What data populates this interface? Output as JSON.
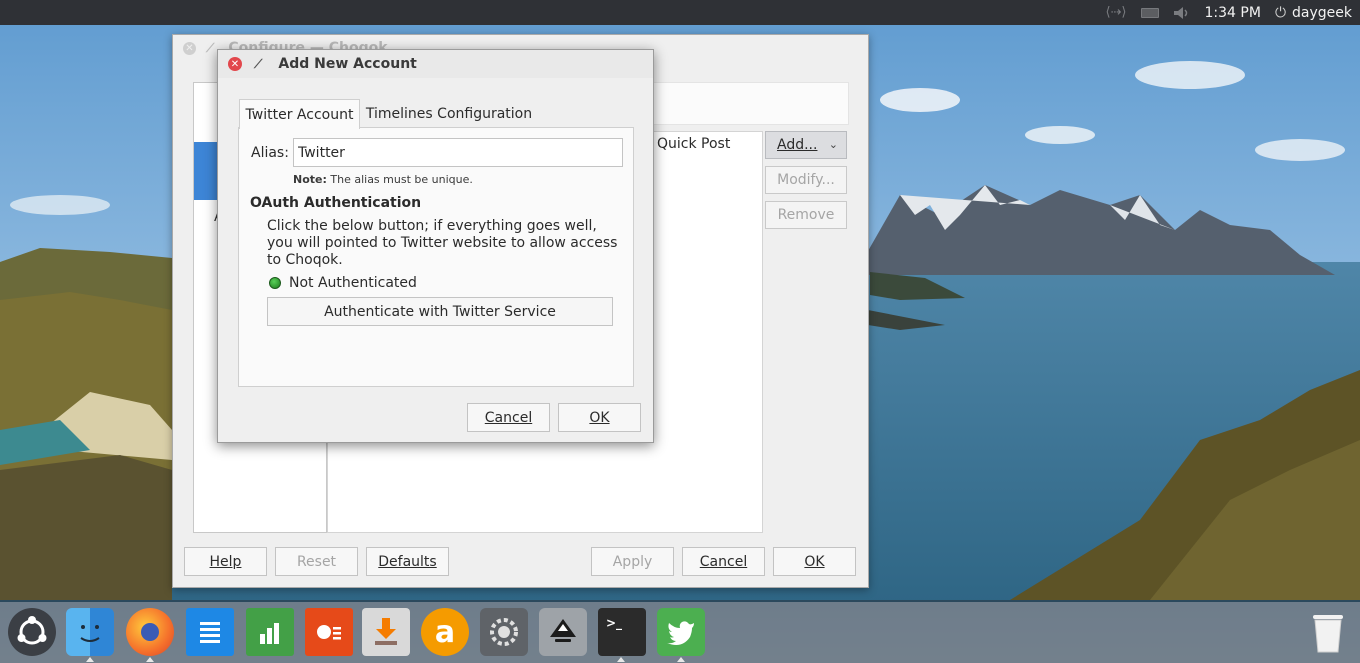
{
  "colors": {
    "accent": "#3d85d6",
    "close_red": "#e2474c",
    "status_green": "#1fa01f",
    "panel_bg": "#2f3136"
  },
  "top_panel": {
    "clock": "1:34 PM",
    "user": "daygeek",
    "icons": [
      "network-icon",
      "battery-icon",
      "volume-icon",
      "power-icon"
    ]
  },
  "config_window": {
    "title": "Configure — Choqok",
    "sidebar_stub": "A",
    "column_quick_post": "Quick Post",
    "buttons": {
      "add": "Add...",
      "modify": "Modify...",
      "remove": "Remove",
      "help": "Help",
      "reset": "Reset",
      "defaults": "Defaults",
      "apply": "Apply",
      "cancel": "Cancel",
      "ok": "OK"
    }
  },
  "dialog": {
    "title": "Add New Account",
    "tabs": [
      {
        "label": "Twitter Account",
        "active": true
      },
      {
        "label": "Timelines Configuration",
        "active": false
      }
    ],
    "alias_label": "Alias:",
    "alias_value": "Twitter",
    "note_bold": "Note:",
    "note_text": " The alias must be unique.",
    "oauth_heading": "OAuth Authentication",
    "oauth_description": "Click the below button; if everything goes well, you will pointed to Twitter website to allow access to Choqok.",
    "status": "Not Authenticated",
    "authenticate_button": "Authenticate with Twitter Service",
    "cancel": "Cancel",
    "ok": "OK"
  },
  "dock": {
    "apps": [
      "ubuntu-logo-icon",
      "finder-icon",
      "firefox-icon",
      "writer-icon",
      "calc-icon",
      "impress-icon",
      "installer-icon",
      "amazon-icon",
      "settings-icon",
      "inkscape-icon",
      "terminal-icon",
      "choqok-icon",
      "trash-icon"
    ]
  }
}
